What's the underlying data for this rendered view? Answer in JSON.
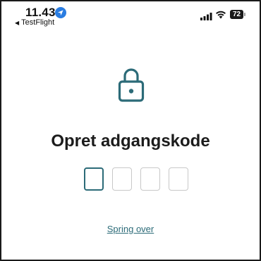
{
  "status_bar": {
    "time": "11.43",
    "back_app": "TestFlight",
    "battery_level": "72",
    "icons": [
      "location-icon",
      "signal-icon",
      "wifi-icon",
      "battery-icon"
    ]
  },
  "passcode": {
    "title": "Opret adgangskode",
    "digit_count": 4,
    "filled_count": 0,
    "active_index": 0,
    "skip_label": "Spring over"
  },
  "colors": {
    "accent": "#2c6b78",
    "text": "#1c1c1c",
    "box_border": "#c8c8c8",
    "location_blue": "#2a7de1"
  },
  "icons": {
    "hero": "lock-icon"
  }
}
